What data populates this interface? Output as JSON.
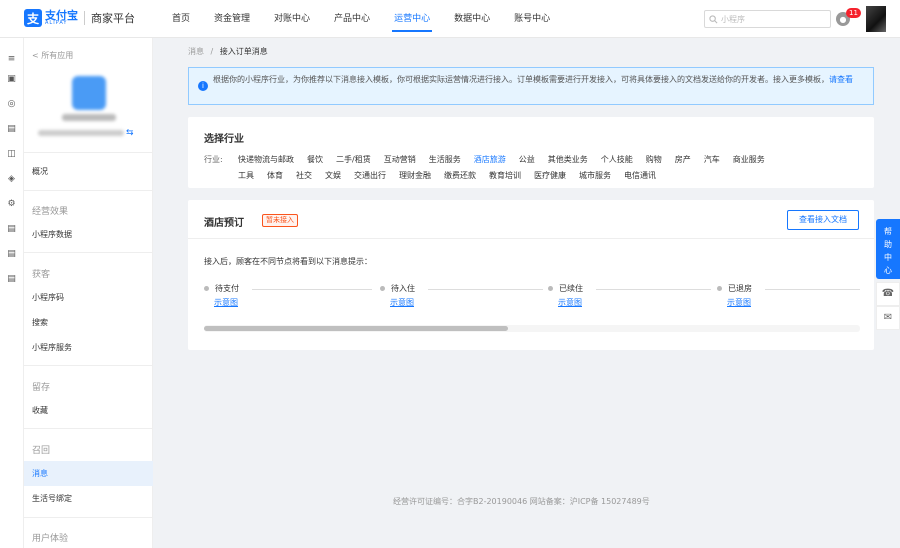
{
  "header": {
    "logo_cn": "支付宝",
    "logo_en": "ALIPAY",
    "platform": "商家平台",
    "nav": [
      "首页",
      "资金管理",
      "对账中心",
      "产品中心",
      "运营中心",
      "数据中心",
      "账号中心"
    ],
    "active_nav": "运营中心",
    "search_placeholder": "小程序",
    "notification_count": "11"
  },
  "sidebar": {
    "back": "< 所有应用",
    "overview": "概况",
    "groups": {
      "effect": "经营效果",
      "effect_items": [
        "小程序数据"
      ],
      "acquire": "获客",
      "acquire_items": [
        "小程序码",
        "搜索",
        "小程序服务"
      ],
      "retain": "留存",
      "retain_items": [
        "收藏"
      ],
      "recall": "召回",
      "recall_items": [
        "消息",
        "生活号绑定"
      ],
      "ux": "用户体验"
    },
    "active_item": "消息"
  },
  "breadcrumb": {
    "parent": "消息",
    "sep": "/",
    "current": "接入订单消息"
  },
  "notice": {
    "text": "根据你的小程序行业，为你推荐以下消息接入模板，你可根据实际运营情况进行接入。订单模板需要进行开发接入，可将具体要接入的文档发送给你的开发者。接入更多模板，",
    "link": "请查看"
  },
  "industry": {
    "title": "选择行业",
    "label": "行业:",
    "row1": [
      "快递物流与邮政",
      "餐饮",
      "二手/租赁",
      "互动营销",
      "生活服务",
      "酒店旅游",
      "公益",
      "其他类业务",
      "个人技能",
      "购物",
      "房产",
      "汽车",
      "商业服务"
    ],
    "row2": [
      "工具",
      "体育",
      "社交",
      "文娱",
      "交通出行",
      "理财金融",
      "缴费还款",
      "教育培训",
      "医疗健康",
      "城市服务",
      "电信通讯"
    ],
    "selected": "酒店旅游"
  },
  "hotel": {
    "title": "酒店预订",
    "tag": "暂未接入",
    "doc_button": "查看接入文档",
    "desc": "接入后，顾客在不同节点将看到以下消息提示：",
    "steps": [
      "待支付",
      "待入住",
      "已续住",
      "已退房"
    ],
    "step_link": "示意图"
  },
  "footer": "经营许可证编号：合字B2-20190046 网站备案：沪ICP备 15027489号",
  "help": {
    "chars": [
      "帮",
      "助",
      "中",
      "心"
    ]
  },
  "colors": {
    "accent": "#1677ff",
    "tag": "#fa541c",
    "badge": "#f5222d"
  }
}
